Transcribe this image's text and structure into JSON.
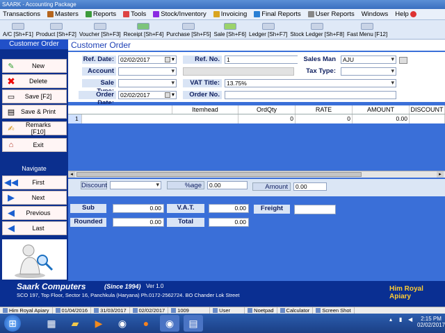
{
  "window": {
    "title": "SAARK - Accounting Package"
  },
  "menu": [
    "Transactions",
    "Masters",
    "Reports",
    "Tools",
    "Stock/Inventory",
    "Invoicing",
    "Final Reports",
    "User Reports",
    "Windows",
    "Help"
  ],
  "toolbar": [
    "A/C [Sh+F1]",
    "Product [Sh+F2]",
    "Voucher [Sh+F3]",
    "Receipt [Sh+F4]",
    "Purchase [Sh+F5]",
    "Sale [Sh+F6]",
    "Ledger [Sh+F7]",
    "Stock Ledger [Sh+F8]",
    "Fast Menu [F12]"
  ],
  "left": {
    "header": "Customer Order",
    "buttons": [
      "New",
      "Delete",
      "Save [F2]",
      "Save & Print",
      "Remarks [F10]",
      "Exit"
    ],
    "nav_label": "Navigate",
    "nav": [
      "First",
      "Next",
      "Previous",
      "Last"
    ]
  },
  "main": {
    "title": "Customer Order",
    "ref_date_label": "Ref. Date:",
    "ref_date": "02/02/2017",
    "ref_no_label": "Ref. No.",
    "ref_no": "1",
    "sales_man_label": "Sales Man",
    "sales_man": "AJU",
    "account_label": "Account",
    "account": "",
    "tax_type_label": "Tax Type:",
    "tax_type": "",
    "sale_type_label": "Sale Type:",
    "sale_type": "",
    "vat_title_label": "VAT Title:",
    "vat_title": "13.75%",
    "order_date_label": "Order Date:",
    "order_date": "02/02/2017",
    "order_no_label": "Order No.",
    "order_no": ""
  },
  "grid": {
    "columns": [
      "Itemhead",
      "OrdQty",
      "RATE",
      "AMOUNT",
      "DISCOUNT"
    ],
    "rows": [
      {
        "num": "1",
        "itemhead": "",
        "ordqty": "0",
        "rate": "0",
        "amount": "0.00",
        "discount": ""
      }
    ]
  },
  "discount": {
    "discount_label": "Discount",
    "discount": "",
    "age_label": "%age",
    "age": "0.00",
    "amount_label": "Amount",
    "amount": "0.00"
  },
  "totals": {
    "sub_label": "Sub",
    "sub": "0.00",
    "vat_label": "V.A.T.",
    "vat": "0.00",
    "freight_label": "Freight",
    "freight": "",
    "rounded_label": "Rounded",
    "rounded": "0.00",
    "total_label": "Total",
    "total": "0.00"
  },
  "footer": {
    "company": "Saark Computers",
    "since": "(Since 1994)",
    "version": "Ver 1.0",
    "address": "SCO 197, Top Floor, Sector 16, Panchkula (Haryana) Ph.0172-2562724.   BO Chander Lok Street",
    "client": "Him Royal Apiary"
  },
  "status": [
    "Him Royal Apiary",
    "01/04/2016",
    "31/03/2017",
    "02/02/2017",
    "1009",
    "User",
    "Noetpad",
    "Calculator",
    "Screen Shot"
  ],
  "clock": {
    "time": "2:15 PM",
    "date": "02/02/2017"
  },
  "colors": {
    "panel_blue": "#3a6fd8",
    "dark_blue": "#0b2f8e",
    "header_text": "#1c3fb5"
  }
}
